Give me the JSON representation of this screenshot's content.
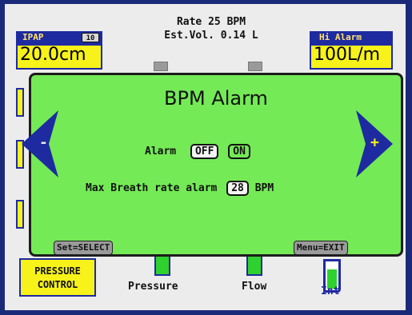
{
  "header": {
    "rate": "Rate 25 BPM",
    "est_vol": "Est.Vol. 0.14 L"
  },
  "ipap_panel": {
    "title": "IPAP",
    "badge": "10",
    "value": "20.0cm"
  },
  "hi_alarm_panel": {
    "title": "Hi Alarm",
    "value": "100L/m"
  },
  "mode_button": {
    "line1": "PRESSURE",
    "line2": "CONTROL"
  },
  "bottom_labels": {
    "pressure": "Pressure",
    "flow": "Flow",
    "int": "Int"
  },
  "dialog": {
    "title": "BPM Alarm",
    "alarm_label": "Alarm",
    "off_label": "OFF",
    "on_label": "ON",
    "max_rate_label": "Max Breath rate alarm",
    "max_rate_value": "28",
    "max_rate_unit": "BPM",
    "minus_symbol": "-",
    "plus_symbol": "+",
    "set_button": "Set=SELECT",
    "menu_button": "Menu=EXIT"
  },
  "colors": {
    "frame": "#1b2a78",
    "dialog_bg": "#74ea56",
    "panel_title_bg": "#1e2aa0",
    "panel_value_bg": "#f6f21a",
    "arrow_fill": "#1e2aa0"
  },
  "icons": {
    "left_arrow": "left-triangle-arrow-icon",
    "right_arrow": "right-triangle-arrow-icon"
  }
}
